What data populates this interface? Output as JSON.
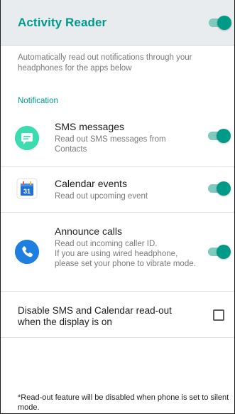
{
  "header": {
    "title": "Activity Reader",
    "master_toggle_on": true
  },
  "description": "Automatically read out notifications through your headphones for the apps below",
  "section": {
    "title": "Notification"
  },
  "apps": [
    {
      "title": "SMS messages",
      "subtitle": "Read out SMS messages from Contacts",
      "icon": "sms-app-icon",
      "toggle_on": true
    },
    {
      "title": "Calendar events",
      "subtitle": "Read out upcoming event",
      "icon": "calendar-app-icon",
      "icon_text": "31",
      "toggle_on": true
    },
    {
      "title": "Announce calls",
      "subtitle": "Read out incoming caller ID.\nIf you are using wired headphone, please set your phone to vibrate mode.",
      "icon": "phone-app-icon",
      "toggle_on": true
    }
  ],
  "option": {
    "label": "Disable SMS and Calendar read-out when the display is on",
    "checked": false
  },
  "footer": {
    "note": "*Read-out feature will be disabled when phone is set to silent mode."
  },
  "colors": {
    "accent": "#00998c",
    "header_bg": "#e9ecee",
    "toggle_track": "#7fc9bf",
    "toggle_knob": "#009a88",
    "sms_icon": "#3ddbb0",
    "phone_icon": "#1e7fe0",
    "calendar_icon": "#1e6fd8"
  }
}
